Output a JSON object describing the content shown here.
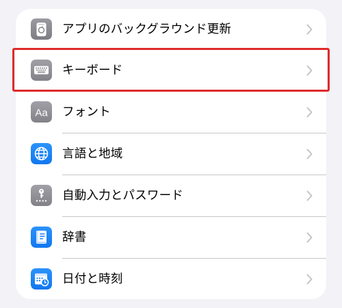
{
  "settings_list": {
    "items": [
      {
        "label": "アプリのバックグラウンド更新",
        "icon": "background-refresh-icon"
      },
      {
        "label": "キーボード",
        "icon": "keyboard-icon"
      },
      {
        "label": "フォント",
        "icon": "font-icon"
      },
      {
        "label": "言語と地域",
        "icon": "globe-icon"
      },
      {
        "label": "自動入力とパスワード",
        "icon": "key-icon"
      },
      {
        "label": "辞書",
        "icon": "dictionary-icon"
      },
      {
        "label": "日付と時刻",
        "icon": "calendar-clock-icon"
      }
    ],
    "highlighted_item": "キーボード"
  },
  "colors": {
    "background": "#f2f2f7",
    "card": "#ffffff",
    "gray_icon": "#8e8e93",
    "blue_icon": "#1a82f7",
    "chevron": "#c4c4c7",
    "highlight": "#e02a2a"
  }
}
